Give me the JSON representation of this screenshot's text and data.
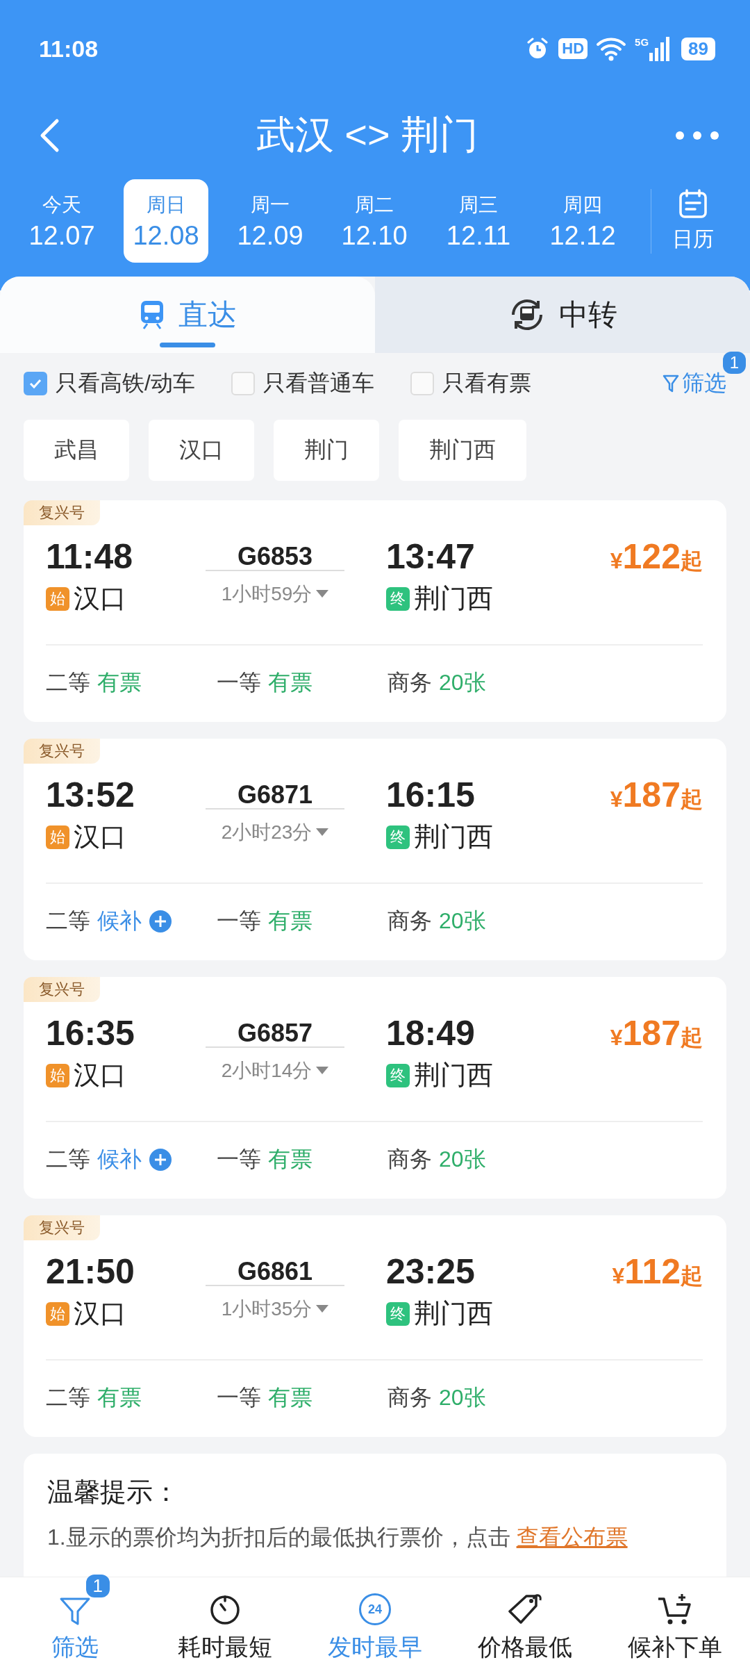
{
  "status_bar": {
    "time": "11:08",
    "hd_label": "HD",
    "network": "5G",
    "battery": "89"
  },
  "header": {
    "title": "武汉 <> 荆门"
  },
  "dates": [
    {
      "weekday": "今天",
      "date": "12.07",
      "selected": false
    },
    {
      "weekday": "周日",
      "date": "12.08",
      "selected": true
    },
    {
      "weekday": "周一",
      "date": "12.09",
      "selected": false
    },
    {
      "weekday": "周二",
      "date": "12.10",
      "selected": false
    },
    {
      "weekday": "周三",
      "date": "12.11",
      "selected": false
    },
    {
      "weekday": "周四",
      "date": "12.12",
      "selected": false
    }
  ],
  "calendar": {
    "label": "日历"
  },
  "tabs": [
    {
      "label": "直达",
      "kind": "direct",
      "selected": true
    },
    {
      "label": "中转",
      "kind": "transfer",
      "selected": false
    }
  ],
  "checkboxes": [
    {
      "label": "只看高铁/动车",
      "checked": true
    },
    {
      "label": "只看普通车",
      "checked": false
    },
    {
      "label": "只看有票",
      "checked": false
    }
  ],
  "filter_button": {
    "label": "筛选",
    "badge": "1"
  },
  "stations": [
    "武昌",
    "汉口",
    "荆门",
    "荆门西"
  ],
  "trains": [
    {
      "badge": "复兴号",
      "depart_time": "11:48",
      "number": "G6853",
      "arrive_time": "13:47",
      "from_tag": "始",
      "from": "汉口",
      "duration": "1小时59分",
      "to_tag": "终",
      "to": "荆门西",
      "currency": "¥",
      "price": "122",
      "price_suffix": "起",
      "seats": [
        {
          "class": "二等",
          "status": "有票",
          "kind": "available"
        },
        {
          "class": "一等",
          "status": "有票",
          "kind": "available"
        },
        {
          "class": "商务",
          "status": "20张",
          "kind": "available"
        }
      ]
    },
    {
      "badge": "复兴号",
      "depart_time": "13:52",
      "number": "G6871",
      "arrive_time": "16:15",
      "from_tag": "始",
      "from": "汉口",
      "duration": "2小时23分",
      "to_tag": "终",
      "to": "荆门西",
      "currency": "¥",
      "price": "187",
      "price_suffix": "起",
      "seats": [
        {
          "class": "二等",
          "status": "候补",
          "kind": "waitlist"
        },
        {
          "class": "一等",
          "status": "有票",
          "kind": "available"
        },
        {
          "class": "商务",
          "status": "20张",
          "kind": "available"
        }
      ]
    },
    {
      "badge": "复兴号",
      "depart_time": "16:35",
      "number": "G6857",
      "arrive_time": "18:49",
      "from_tag": "始",
      "from": "汉口",
      "duration": "2小时14分",
      "to_tag": "终",
      "to": "荆门西",
      "currency": "¥",
      "price": "187",
      "price_suffix": "起",
      "seats": [
        {
          "class": "二等",
          "status": "候补",
          "kind": "waitlist"
        },
        {
          "class": "一等",
          "status": "有票",
          "kind": "available"
        },
        {
          "class": "商务",
          "status": "20张",
          "kind": "available"
        }
      ]
    },
    {
      "badge": "复兴号",
      "depart_time": "21:50",
      "number": "G6861",
      "arrive_time": "23:25",
      "from_tag": "始",
      "from": "汉口",
      "duration": "1小时35分",
      "to_tag": "终",
      "to": "荆门西",
      "currency": "¥",
      "price": "112",
      "price_suffix": "起",
      "seats": [
        {
          "class": "二等",
          "status": "有票",
          "kind": "available"
        },
        {
          "class": "一等",
          "status": "有票",
          "kind": "available"
        },
        {
          "class": "商务",
          "status": "20张",
          "kind": "available"
        }
      ]
    }
  ],
  "tips": {
    "title": "温馨提示：",
    "text": "1.显示的票价均为折扣后的最低执行票价，点击",
    "link": "查看公布票"
  },
  "bottom_nav": [
    {
      "label": "筛选",
      "kind": "filter",
      "active": true,
      "badge": "1"
    },
    {
      "label": "耗时最短",
      "kind": "duration",
      "active": false
    },
    {
      "label": "发时最早",
      "kind": "earliest",
      "active": true,
      "icon_text": "24"
    },
    {
      "label": "价格最低",
      "kind": "price",
      "active": false
    },
    {
      "label": "候补下单",
      "kind": "waitlist",
      "active": false
    }
  ]
}
